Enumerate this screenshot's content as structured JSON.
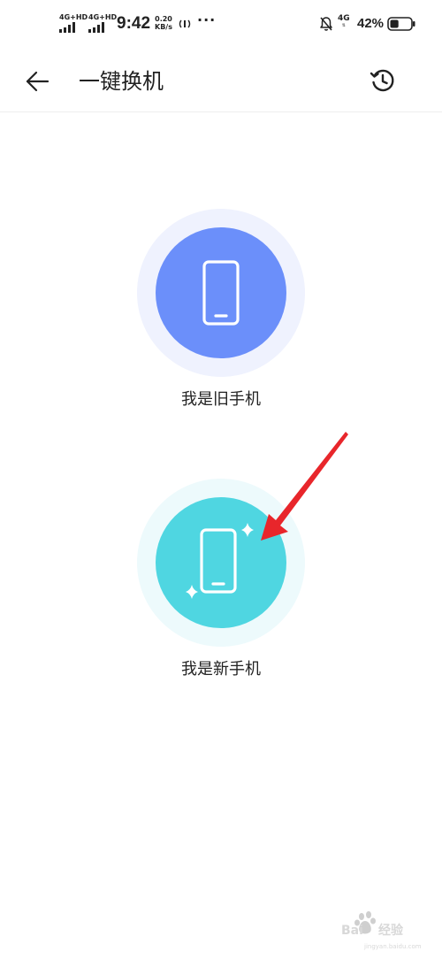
{
  "status_bar": {
    "sim1_network": "4G+HD",
    "sim2_network": "4G+HD",
    "time": "9:42",
    "speed_value": "0.20",
    "speed_unit": "KB/s",
    "more": "···",
    "network_right": "4G",
    "battery_percent": "42%",
    "battery_level": 0.42
  },
  "app_bar": {
    "title": "一键换机",
    "back_icon": "arrow-left-icon",
    "history_icon": "history-clock-icon"
  },
  "options": {
    "old_phone": {
      "label": "我是旧手机",
      "color": "#6b8ffa",
      "halo_color": "#eff2fe",
      "icon": "phone-icon"
    },
    "new_phone": {
      "label": "我是新手机",
      "color": "#4fd6e1",
      "halo_color": "#edfafc",
      "icon": "phone-sparkle-icon"
    }
  },
  "annotation": {
    "arrow_color": "#e8262b"
  }
}
